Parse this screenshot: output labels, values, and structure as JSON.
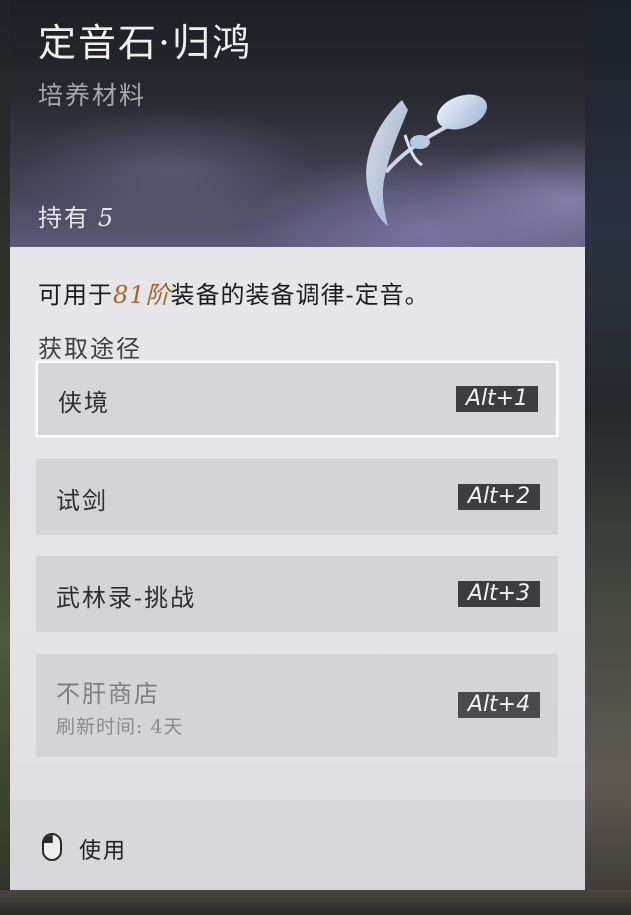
{
  "item": {
    "name": "定音石·归鸿",
    "category": "培养材料",
    "owned_label": "持有",
    "owned_count": "5"
  },
  "description": {
    "prefix": "可用于",
    "highlight": "81阶",
    "suffix": "装备的装备调律-定音。",
    "highlight_color": "#a2672d"
  },
  "sources": {
    "title": "获取途径",
    "items": [
      {
        "label": "侠境",
        "key": "Alt+1",
        "selected": true
      },
      {
        "label": "试剑",
        "key": "Alt+2"
      },
      {
        "label": "武林录-挑战",
        "key": "Alt+3"
      },
      {
        "label": "不肝商店",
        "sub": "刷新时间: 4天",
        "key": "Alt+4",
        "dim": true
      }
    ]
  },
  "footer": {
    "icon": "mouse-left-click-icon",
    "action_label": "使用"
  }
}
